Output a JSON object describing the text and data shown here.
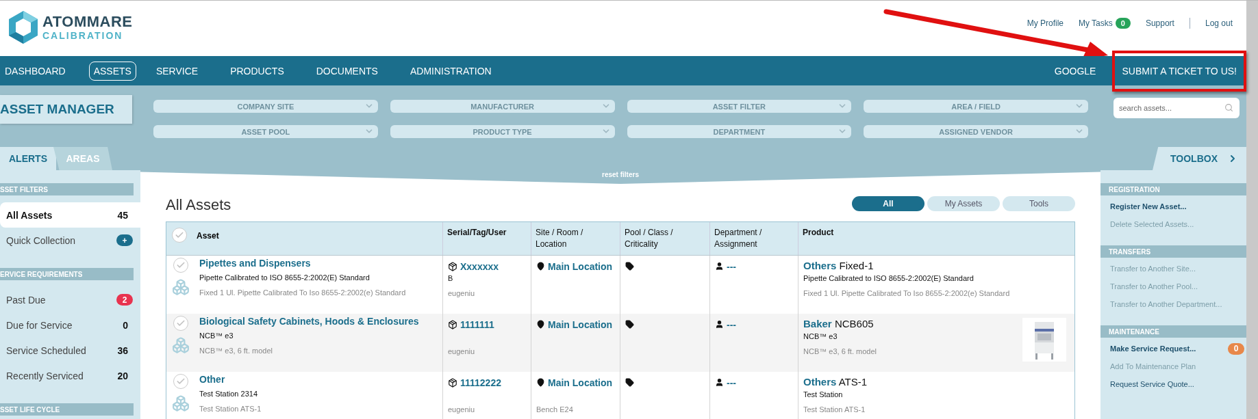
{
  "header": {
    "logo": {
      "name": "ATOMMARE",
      "tagline": "CALIBRATION"
    },
    "user_links": [
      {
        "label": "My Profile"
      },
      {
        "label": "My Tasks",
        "badge": "0"
      },
      {
        "label": "Support"
      },
      {
        "label": "Log out"
      }
    ]
  },
  "nav": {
    "items": [
      {
        "label": "DASHBOARD",
        "selected": false
      },
      {
        "label": "ASSETS",
        "selected": true
      },
      {
        "label": "SERVICE",
        "selected": false
      },
      {
        "label": "PRODUCTS",
        "selected": false
      },
      {
        "label": "DOCUMENTS",
        "selected": false
      },
      {
        "label": "ADMINISTRATION",
        "selected": false
      }
    ],
    "right_items": [
      {
        "label": "GOOGLE",
        "highlighted": false
      },
      {
        "label": "SUBMIT A TICKET TO US!",
        "highlighted": true
      }
    ]
  },
  "filters": {
    "title": "ASSET MANAGER",
    "dropdowns": [
      {
        "label": "COMPANY SITE"
      },
      {
        "label": "MANUFACTURER"
      },
      {
        "label": "ASSET FILTER"
      },
      {
        "label": "AREA / FIELD"
      },
      {
        "label": "ASSET POOL"
      },
      {
        "label": "PRODUCT TYPE"
      },
      {
        "label": "DEPARTMENT"
      },
      {
        "label": "ASSIGNED VENDOR"
      }
    ],
    "search": {
      "placeholder": "search assets..."
    }
  },
  "left_tabs": [
    {
      "label": "ALERTS",
      "selected": true
    },
    {
      "label": "AREAS",
      "selected": false
    }
  ],
  "reset_filters": "reset filters",
  "toolbox": {
    "label": "TOOLBOX"
  },
  "sidebar": {
    "sections": [
      {
        "title": "SSET FILTERS",
        "items": [
          {
            "label": "All Assets",
            "count": "45",
            "kind": "count",
            "selected": true
          },
          {
            "label": "Quick Collection",
            "count": "+",
            "kind": "badge",
            "color": "#1b6e8c",
            "selected": false
          }
        ]
      },
      {
        "title": "ERVICE REQUIREMENTS",
        "items": [
          {
            "label": "Past Due",
            "count": "2",
            "kind": "badge",
            "color": "#e8334f",
            "selected": false
          },
          {
            "label": "Due for Service",
            "count": "0",
            "kind": "count",
            "selected": false
          },
          {
            "label": "Service Scheduled",
            "count": "36",
            "kind": "count",
            "selected": false
          },
          {
            "label": "Recently Serviced",
            "count": "20",
            "kind": "count",
            "selected": false
          }
        ]
      },
      {
        "title": "SSET LIFE CYCLE"
      }
    ]
  },
  "main": {
    "title": "All Assets",
    "views": [
      {
        "label": "All",
        "selected": true
      },
      {
        "label": "My Assets",
        "selected": false
      },
      {
        "label": "Tools",
        "selected": false
      }
    ],
    "table": {
      "select_all_checked": false,
      "columns": [
        "Asset",
        "Serial/Tag/User",
        "Site / Room / Location",
        "Pool / Class / Criticality",
        "Department / Assignment",
        "Product"
      ],
      "rows": [
        {
          "checked": false,
          "asset": {
            "name": "Pipettes and Dispensers",
            "line_2": "Pipette Calibrated to ISO 8655-2:2002(E) Standard",
            "line_3": "Fixed 1 Ul. Pipette Calibrated To Iso 8655-2:2002(e) Standard"
          },
          "serial": "Xxxxxxx",
          "tag": "B",
          "user": "eugeniu",
          "location": "Main Location",
          "assignment": "---",
          "product": {
            "brand": "Others",
            "model": "Fixed-1",
            "line_2": "Pipette Calibrated to ISO 8655-2:2002(E) Standard",
            "line_3": "Fixed 1 Ul. Pipette Calibrated To Iso 8655-2:2002(e) Standard"
          }
        },
        {
          "checked": false,
          "asset": {
            "name": "Biological Safety Cabinets, Hoods & Enclosures",
            "line_2": "NCB™ e3",
            "line_3": "NCB™ e3, 6 ft. model"
          },
          "serial": "1111111",
          "user": "eugeniu",
          "location": "Main Location",
          "assignment": "---",
          "product": {
            "brand": "Baker",
            "model": "NCB605",
            "line_2": "NCB™ e3",
            "line_3": "NCB™ e3, 6 ft. model"
          }
        },
        {
          "checked": false,
          "asset": {
            "name": "Other",
            "line_2": "Test Station 2314",
            "line_3": "Test Station ATS-1"
          },
          "serial": "11112222",
          "user": "eugeniu",
          "location": "Main Location",
          "room": "Bench E24",
          "assignment": "---",
          "product": {
            "brand": "Others",
            "model": "ATS-1",
            "line_2": "Test Station",
            "line_3": "Test Station ATS-1"
          }
        }
      ]
    }
  },
  "toolbox_panel": {
    "sections": [
      {
        "title": "REGISTRATION",
        "items": [
          {
            "label": "Register New Asset...",
            "disabled": false,
            "emphasis": true
          },
          {
            "label": "Delete Selected Assets...",
            "disabled": true,
            "emphasis": false
          }
        ]
      },
      {
        "title": "TRANSFERS",
        "items": [
          {
            "label": "Transfer to Another Site...",
            "disabled": true,
            "emphasis": false
          },
          {
            "label": "Transfer to Another Pool...",
            "disabled": true,
            "emphasis": false
          },
          {
            "label": "Transfer to Another Department...",
            "disabled": true,
            "emphasis": false
          }
        ]
      },
      {
        "title": "MAINTENANCE",
        "items": [
          {
            "label": "Make Service Request...",
            "disabled": false,
            "emphasis": true,
            "badge": "0"
          },
          {
            "label": "Add To Maintenance Plan",
            "disabled": true,
            "emphasis": false
          },
          {
            "label": "Request Service Quote...",
            "disabled": false,
            "emphasis": false
          }
        ]
      }
    ]
  }
}
